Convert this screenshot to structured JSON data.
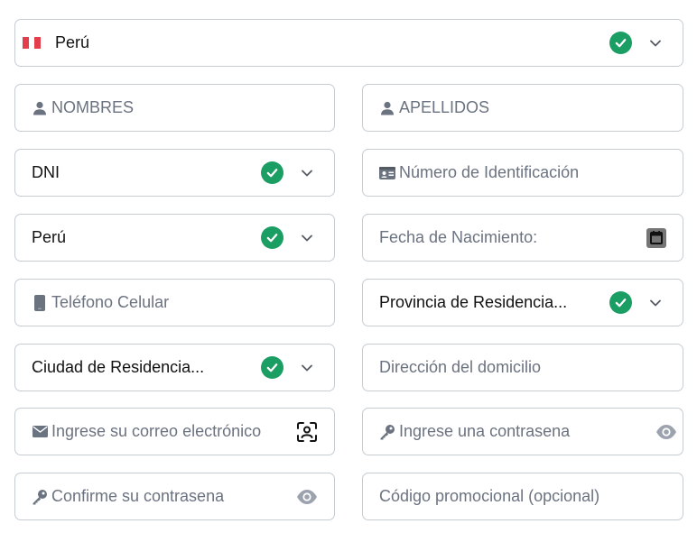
{
  "form": {
    "country": {
      "value": "Perú",
      "icon": "peru-flag-icon",
      "valid": true
    },
    "first_names": {
      "placeholder": "NOMBRES",
      "icon": "user-icon"
    },
    "last_names": {
      "placeholder": "APELLIDOS",
      "icon": "user-icon"
    },
    "document_type": {
      "value": "DNI",
      "valid": true
    },
    "id_number": {
      "placeholder": "Número de Identificación",
      "icon": "id-card-icon"
    },
    "nationality": {
      "value": "Perú",
      "valid": true
    },
    "birth_date": {
      "placeholder": "Fecha de Nacimiento:",
      "icon": "calendar-icon"
    },
    "mobile_phone": {
      "placeholder": "Teléfono Celular",
      "icon": "mobile-phone-icon"
    },
    "province": {
      "value": "Provincia de Residencia...",
      "valid": true
    },
    "city": {
      "value": "Ciudad de Residencia...",
      "valid": true
    },
    "address": {
      "placeholder": "Dirección del domicilio"
    },
    "email": {
      "placeholder": "Ingrese su correo electrónico",
      "icon": "envelope-icon",
      "trailing_icon": "face-scan-icon"
    },
    "password": {
      "placeholder": "Ingrese una contrasena",
      "icon": "key-icon",
      "trailing_icon": "eye-icon"
    },
    "confirm_password": {
      "placeholder": "Confirme su contrasena",
      "icon": "key-icon",
      "trailing_icon": "eye-icon"
    },
    "promo_code": {
      "placeholder": "Código promocional (opcional)"
    }
  },
  "colors": {
    "valid_green": "#1a9e63",
    "border": "#c7ccd3",
    "icon_gray": "#6b7280",
    "text": "#111111"
  }
}
